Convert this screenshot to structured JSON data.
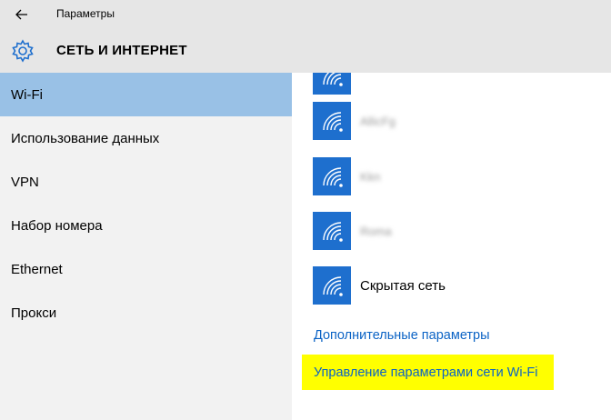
{
  "window": {
    "title": "Параметры"
  },
  "header": {
    "section_title": "СЕТЬ И ИНТЕРНЕТ"
  },
  "sidebar": {
    "items": [
      {
        "label": "Wi-Fi",
        "selected": true
      },
      {
        "label": "Использование данных",
        "selected": false
      },
      {
        "label": "VPN",
        "selected": false
      },
      {
        "label": "Набор номера",
        "selected": false
      },
      {
        "label": "Ethernet",
        "selected": false
      },
      {
        "label": "Прокси",
        "selected": false
      }
    ]
  },
  "networks": [
    {
      "name": "",
      "blurred": true
    },
    {
      "name": "AllicFg",
      "blurred": true
    },
    {
      "name": "Kkn",
      "blurred": true
    },
    {
      "name": "Roma",
      "blurred": true
    },
    {
      "name": "Скрытая сеть",
      "blurred": false
    }
  ],
  "links": {
    "advanced": "Дополнительные параметры",
    "manage_wifi": "Управление параметрами сети Wi-Fi"
  },
  "colors": {
    "accent": "#1e6fce",
    "selected_nav": "#99c1e6",
    "link": "#0b63c5",
    "highlight": "#ffff00"
  },
  "icons": {
    "back": "back-arrow-icon",
    "header": "gear-icon",
    "network": "wifi-icon"
  }
}
